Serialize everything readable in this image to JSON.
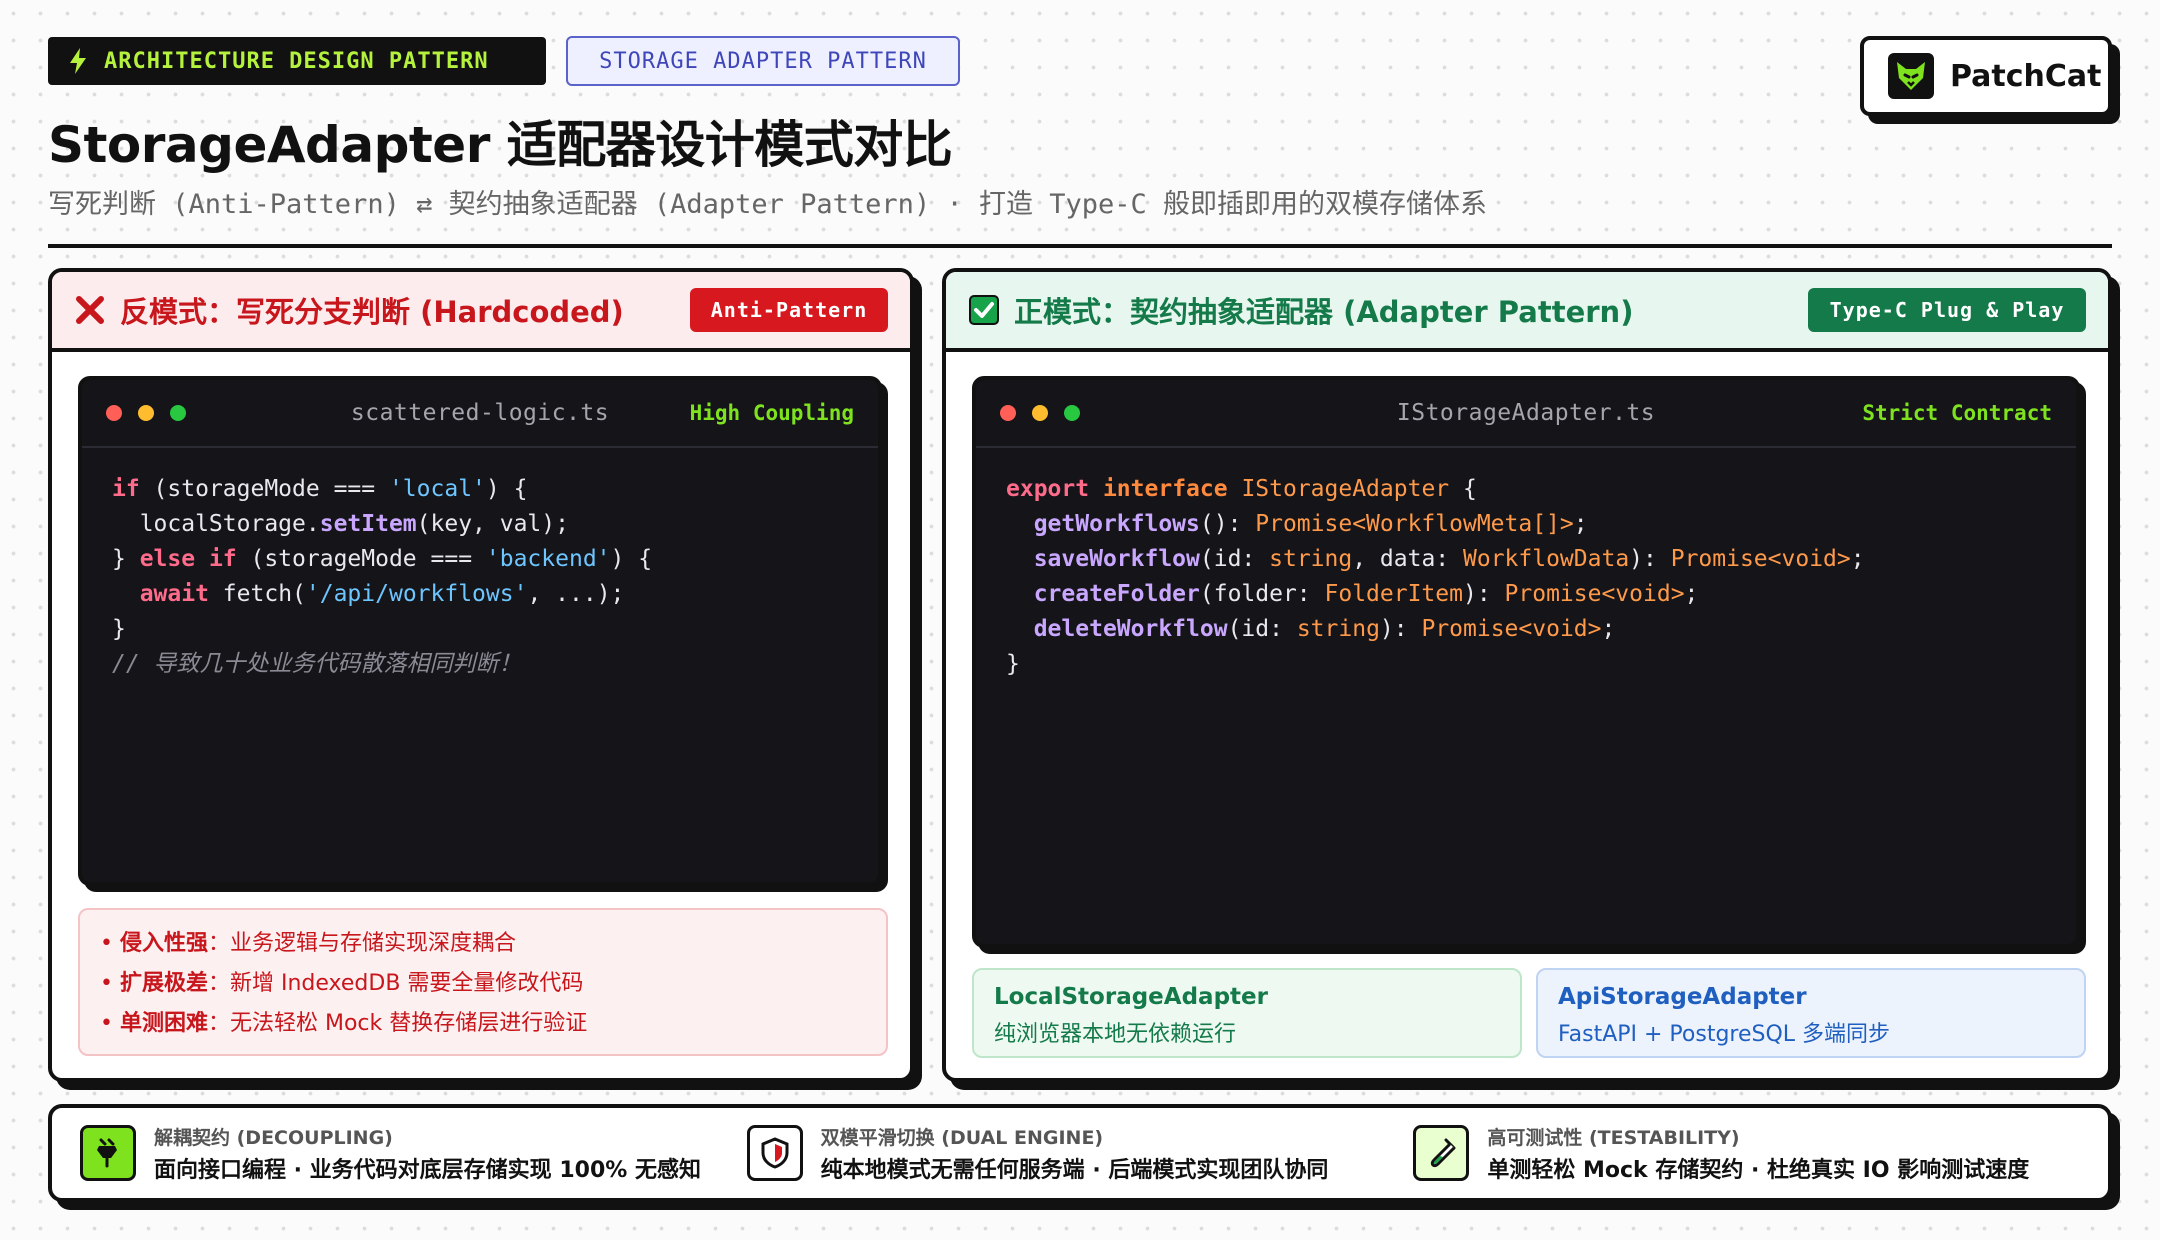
{
  "header": {
    "tag_primary": "ARCHITECTURE DESIGN PATTERN",
    "tag_secondary": "STORAGE ADAPTER PATTERN",
    "title": "StorageAdapter 适配器设计模式对比",
    "subtitle": "写死判断 (Anti-Pattern) ⇄ 契约抽象适配器 (Adapter Pattern) · 打造 Type-C 般即插即用的双模存储体系",
    "brand_name": "PatchCat"
  },
  "anti": {
    "title": "反模式：写死分支判断 (Hardcoded)",
    "badge": "Anti-Pattern",
    "code_file": "scattered-logic.ts",
    "code_tag": "High Coupling",
    "bullets": [
      {
        "key": "侵入性强",
        "text": "：业务逻辑与存储实现深度耦合"
      },
      {
        "key": "扩展极差",
        "text": "：新增 IndexedDB 需要全量修改代码"
      },
      {
        "key": "单测困难",
        "text": "：无法轻松 Mock 替换存储层进行验证"
      }
    ],
    "bullet_dot": "•"
  },
  "pattern": {
    "title": "正模式：契约抽象适配器 (Adapter Pattern)",
    "badge": "Type-C Plug & Play",
    "code_file": "IStorageAdapter.ts",
    "code_tag": "Strict Contract",
    "adapters": [
      {
        "name": "LocalStorageAdapter",
        "desc": "纯浏览器本地无依赖运行"
      },
      {
        "name": "ApiStorageAdapter",
        "desc": "FastAPI + PostgreSQL 多端同步"
      }
    ]
  },
  "footer": {
    "features": [
      {
        "label": "解耦契约 (DECOUPLING)",
        "desc": "面向接口编程 · 业务代码对底层存储实现 100% 无感知",
        "icon": "plug-icon"
      },
      {
        "label": "双模平滑切换 (DUAL ENGINE)",
        "desc": "纯本地模式无需任何服务端 · 后端模式实现团队协同",
        "icon": "shield-icon"
      },
      {
        "label": "高可测试性 (TESTABILITY)",
        "desc": "单测轻松 Mock 存储契约 · 杜绝真实 IO 影响测试速度",
        "icon": "test-tube-icon"
      }
    ]
  },
  "colors": {
    "accent_lime": "#7ee21f",
    "anti_red": "#d7191f",
    "pattern_green": "#147a4a",
    "api_blue": "#1f5fbf"
  }
}
